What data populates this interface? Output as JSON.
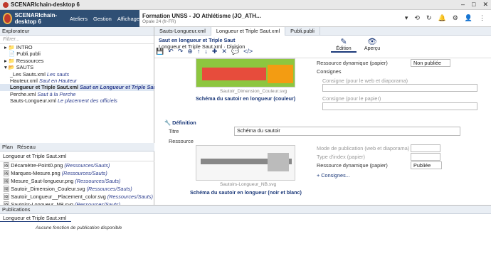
{
  "app": {
    "title": "SCENARIchain-desktop 6",
    "workspace": "SCENARIchain-desktop 6",
    "menus": [
      "Ateliers",
      "Gestion",
      "Affichage"
    ]
  },
  "doc": {
    "title": "Formation UNSS - JO Athlétisme (JO_ATH...",
    "subtitle": "Opale 24 (fr-FR)"
  },
  "left": {
    "tabs": [
      "Explorateur"
    ],
    "filter_placeholder": "Filtrer...",
    "tree": [
      "INTRO",
      "Publi.publi",
      "Ressources",
      "SAUTS"
    ],
    "sauts": [
      {
        "name": "_Les Sauts.xml",
        "title": "Les sauts"
      },
      {
        "name": "Hauteur.xml",
        "title": "Saut en Hauteur"
      },
      {
        "name": "Longueur et Triple Saut.xml",
        "title": "Saut en Longueur et Triple Saut"
      },
      {
        "name": "Perche.xml",
        "title": "Saut à la Perche"
      },
      {
        "name": "Sauts-Longueur.xml",
        "title": "Le placement des officiels"
      }
    ]
  },
  "plan": {
    "tabs": [
      "Plan",
      "Réseau"
    ],
    "current": "Longueur et Triple Saut.xml",
    "items": [
      {
        "name": "Décamètre-Point0.png",
        "path": "(Ressources/Sauts)"
      },
      {
        "name": "Marques-Mesure.png",
        "path": "(Ressources/Sauts)"
      },
      {
        "name": "Mesure_Saut-longueur.png",
        "path": "(Ressources/Sauts)"
      },
      {
        "name": "Sautoir_Dimension_Couleur.svg",
        "path": "(Ressources/Sauts)"
      },
      {
        "name": "Sautoir_Longueur__Placement_color.svg",
        "path": "(Ressources/Sauts)"
      },
      {
        "name": "Sautoirs-Longueur_NB.svg",
        "path": "(Ressources/Sauts)"
      }
    ]
  },
  "editor": {
    "tabs": [
      "Sauts-Longueur.xml",
      "Longueur et Triple Saut.xml",
      "Publi.publi"
    ],
    "crumb_title": "Saut en longueur et Triple Saut",
    "crumb_sub": "Longueur et Triple Saut.xml · Division",
    "modes": [
      "Édition",
      "Aperçu"
    ],
    "img1": {
      "file": "Sautoir_Dimension_Couleur.svg",
      "caption": "Schéma du sautoir en longueur (couleur)"
    },
    "fields1": {
      "res_dyn": "Ressource dynamique (papier)",
      "res_dyn_val": "Non publiée",
      "consignes": "Consignes",
      "web": "Consigne (pour le web et diaporama)",
      "paper": "Consigne (pour le papier)"
    },
    "def": {
      "title": "Définition",
      "titre_label": "Titre",
      "titre_value": "Schéma du sautoir",
      "ressource": "Ressource"
    },
    "img2": {
      "file": "Sautoirs-Longueur_NB.svg",
      "caption": "Schéma du sautoir en longueur (noir et blanc)"
    },
    "fields2": {
      "mode": "Mode de publication (web et diaporama)",
      "index": "Type d'index (papier)",
      "res_dyn": "Ressource dynamique (papier)",
      "res_dyn_val": "Publiée",
      "more": "+ Consignes..."
    }
  },
  "pub": {
    "title": "Publications",
    "selected": "Longueur et Triple Saut.xml",
    "none": "Aucune fonction de publication disponible"
  }
}
